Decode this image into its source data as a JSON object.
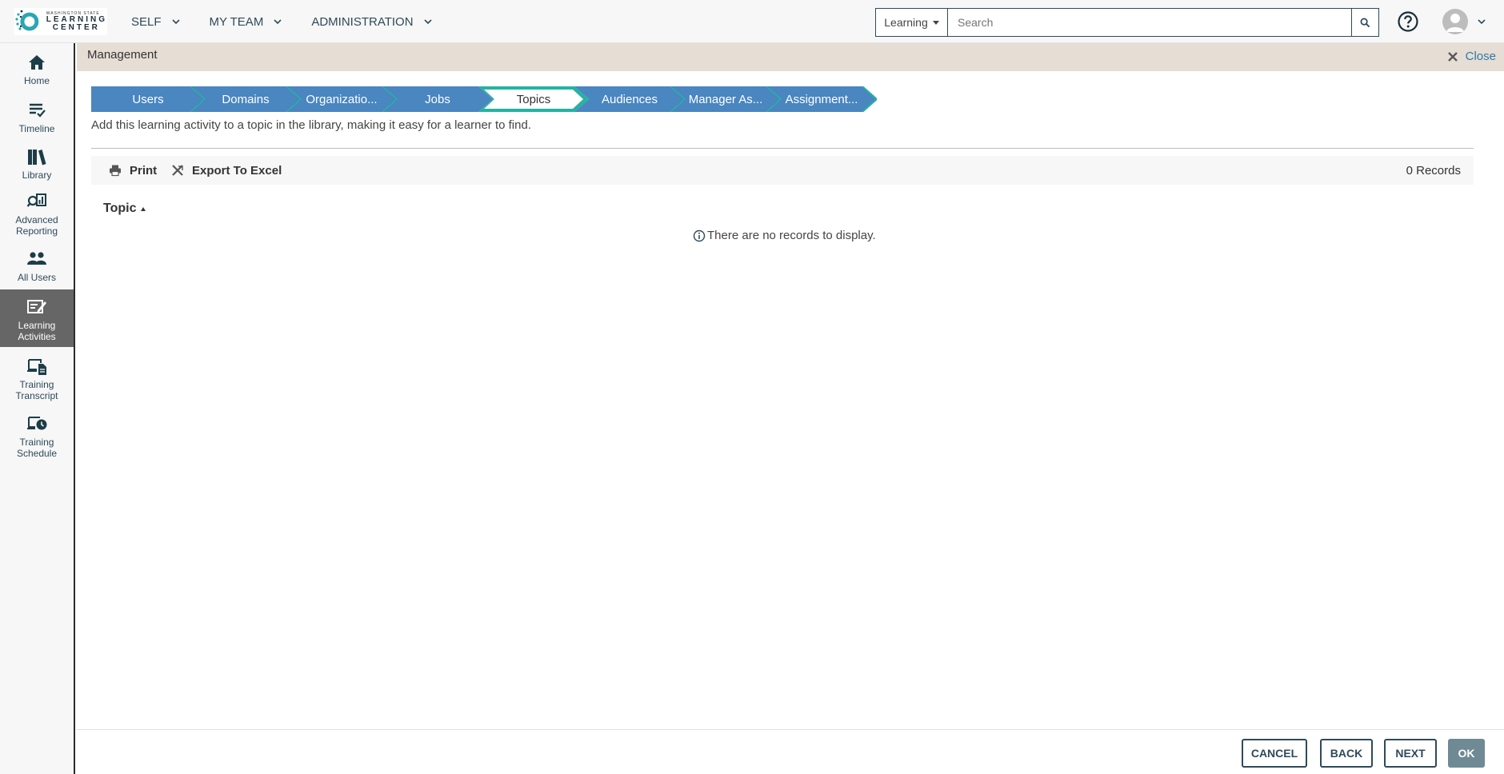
{
  "header": {
    "logo_small": "WASHINGTON STATE",
    "logo_line1": "LEARNING",
    "logo_line2": "CENTER",
    "nav": [
      {
        "label": "SELF"
      },
      {
        "label": "MY TEAM"
      },
      {
        "label": "ADMINISTRATION"
      }
    ],
    "search_scope": "Learning",
    "search_placeholder": "Search"
  },
  "sidebar": {
    "items": [
      {
        "label": "Home",
        "icon": "home-icon"
      },
      {
        "label": "Timeline",
        "icon": "timeline-icon"
      },
      {
        "label": "Library",
        "icon": "library-icon"
      },
      {
        "label": "Advanced Reporting",
        "icon": "reporting-icon"
      },
      {
        "label": "All Users",
        "icon": "users-icon"
      },
      {
        "label": "Learning Activities",
        "icon": "learning-activities-icon",
        "active": true
      },
      {
        "label": "Training Transcript",
        "icon": "transcript-icon"
      },
      {
        "label": "Training Schedule",
        "icon": "schedule-icon"
      }
    ]
  },
  "panel": {
    "title": "Management",
    "close_label": "Close"
  },
  "steps": [
    {
      "label": "Users"
    },
    {
      "label": "Domains"
    },
    {
      "label": "Organizatio..."
    },
    {
      "label": "Jobs"
    },
    {
      "label": "Topics",
      "active": true
    },
    {
      "label": "Audiences"
    },
    {
      "label": "Manager As..."
    },
    {
      "label": "Assignment..."
    }
  ],
  "description": "Add this learning activity to a topic in the library, making it easy for a learner to find.",
  "toolbar": {
    "print_label": "Print",
    "export_label": "Export To Excel",
    "records": "0 Records"
  },
  "table": {
    "column": "Topic",
    "empty_message": "There are no records to display."
  },
  "footer": {
    "cancel": "CANCEL",
    "back": "BACK",
    "next": "NEXT",
    "ok": "OK"
  },
  "colors": {
    "step_fill": "#4a86c0",
    "step_active": "#ffffff",
    "step_accent": "#24b3a1",
    "brand_dark": "#2e4a5a"
  }
}
